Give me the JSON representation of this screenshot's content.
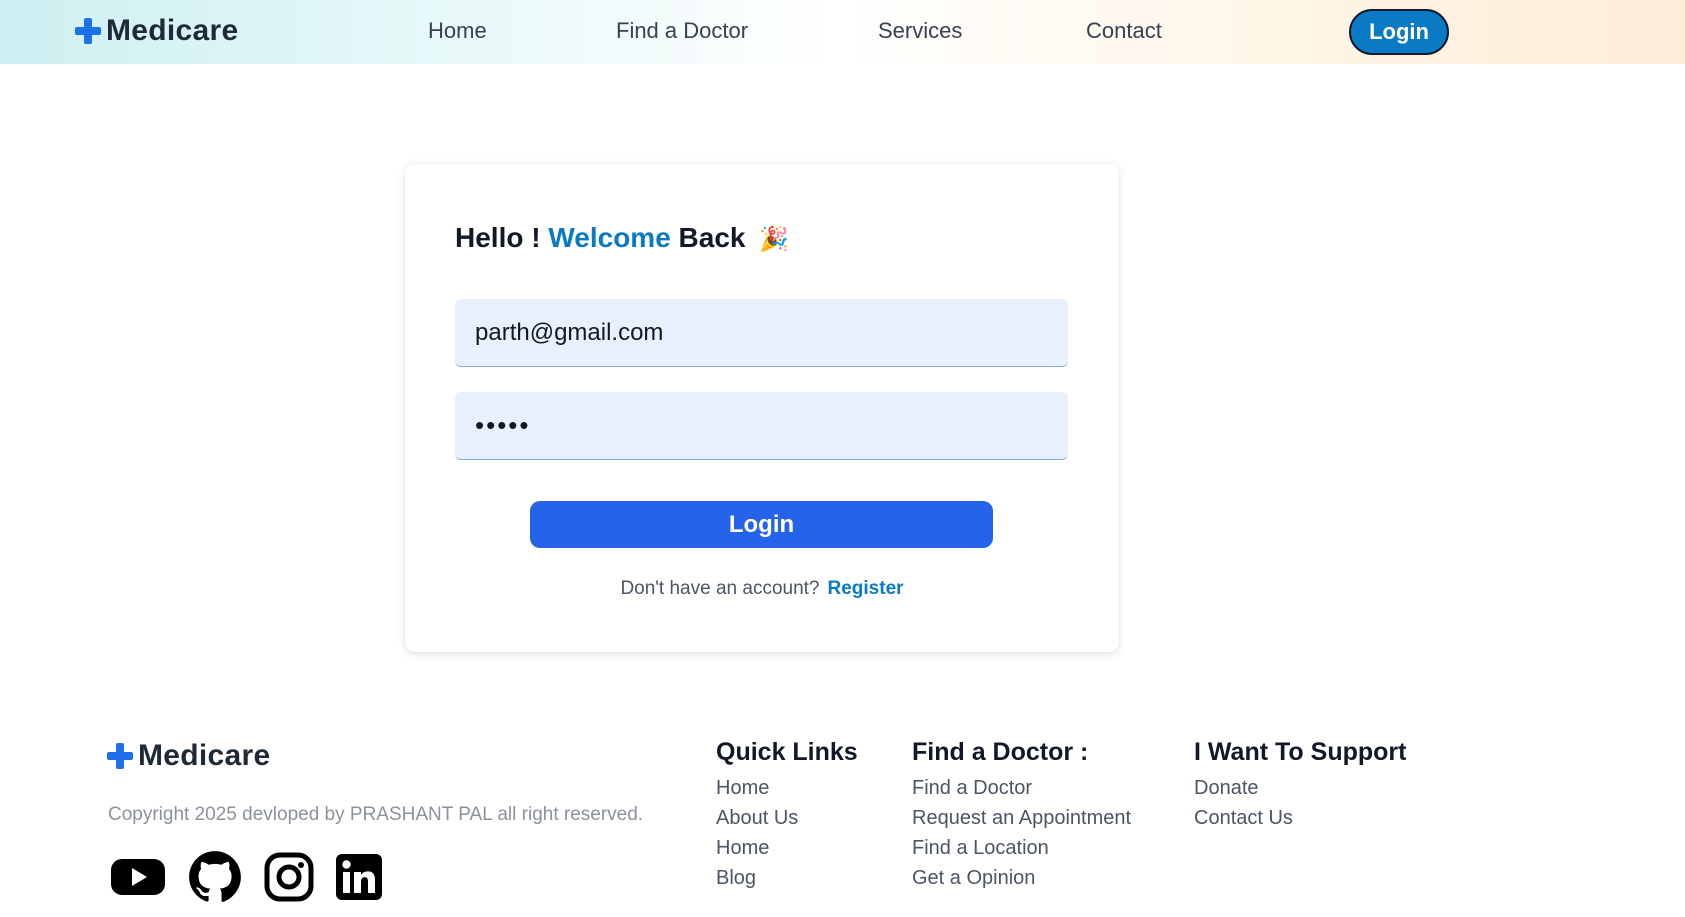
{
  "header": {
    "brand": "Medicare",
    "nav": [
      "Home",
      "Find a Doctor",
      "Services",
      "Contact"
    ],
    "login_label": "Login"
  },
  "login_card": {
    "title_hello": "Hello !",
    "title_welcome": "Welcome",
    "title_back": "Back",
    "title_emoji": "🎉",
    "email_value": "parth@gmail.com",
    "password_value": "•••••",
    "submit_label": "Login",
    "register_prompt": "Don't have an account?",
    "register_link": "Register"
  },
  "footer": {
    "brand": "Medicare",
    "copyright": "Copyright 2025 devloped by PRASHANT PAL all right reserved.",
    "socials": [
      "youtube-icon",
      "github-icon",
      "instagram-icon",
      "linkedin-icon"
    ],
    "columns": [
      {
        "title": "Quick Links",
        "links": [
          "Home",
          "About Us",
          "Home",
          "Blog"
        ]
      },
      {
        "title": "Find a Doctor :",
        "links": [
          "Find a Doctor",
          "Request an Appointment",
          "Find a Location",
          "Get a Opinion"
        ]
      },
      {
        "title": "I Want To Support",
        "links": [
          "Donate",
          "Contact Us"
        ]
      }
    ]
  },
  "colors": {
    "brand_blue": "#1d6fe8",
    "accent": "#0a7ac4",
    "button": "#2563eb",
    "input_bg": "#e8effd"
  }
}
